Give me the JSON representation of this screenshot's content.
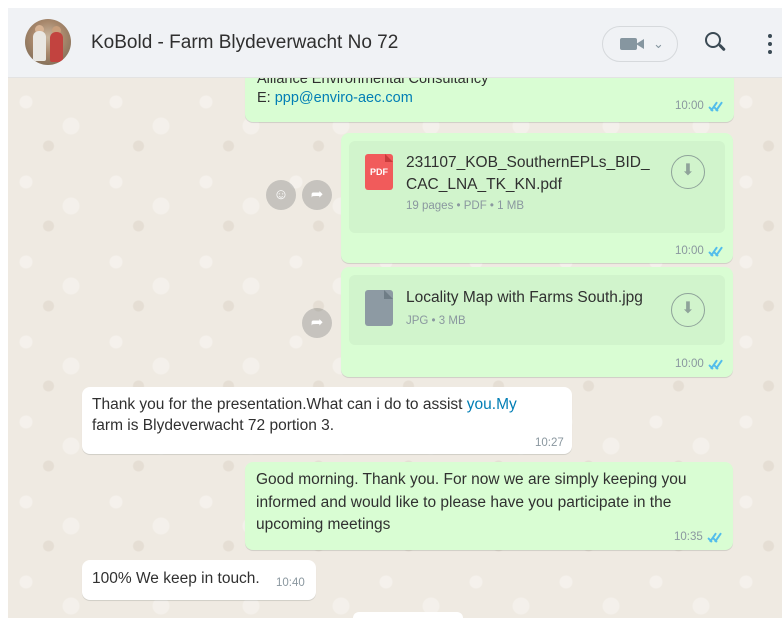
{
  "header": {
    "title": "KoBold - Farm Blydeverwacht No 72",
    "icons": {
      "avatar": "group-avatar",
      "call": "video-call-icon",
      "search": "search-icon",
      "menu": "more-vertical-icon"
    }
  },
  "messages": {
    "m1": {
      "line1": "Alliance Environmental Consultancy",
      "prefix": "E: ",
      "email": "ppp@enviro-aec.com",
      "time": "10:00"
    },
    "m2": {
      "icon_label": "PDF",
      "file_line1": "231107_KOB_SouthernEPLs_BID_",
      "file_line2": "CAC_LNA_TK_KN.pdf",
      "meta": "19 pages • PDF • 1 MB",
      "time": "10:00"
    },
    "m3": {
      "file_name": "Locality Map with Farms South.jpg",
      "meta": "JPG • 3 MB",
      "time": "10:00"
    },
    "m4": {
      "line1_text": "Thank you for the presentation.What can i do to assist ",
      "line1_link": "you.My",
      "line2": "farm is Blydeverwacht 72 portion 3.",
      "time": "10:27"
    },
    "m5": {
      "line1": "Good morning. Thank you. For now we are simply keeping you",
      "line2": "informed  and would like to please have you participate in the",
      "line3": "upcoming meetings",
      "time": "10:35"
    },
    "m6": {
      "text": "100% We keep in touch.",
      "time": "10:40"
    }
  },
  "colors": {
    "outgoing": "#d9fdd3",
    "incoming": "#ffffff",
    "read_ticks": "#53bdeb",
    "link": "#027eb5"
  }
}
